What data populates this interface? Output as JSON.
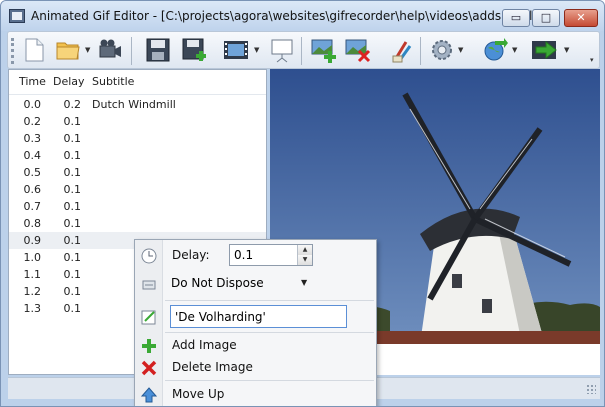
{
  "window": {
    "title": "Animated Gif Editor - [C:\\projects\\agora\\websites\\gifrecorder\\help\\videos\\addsubtitle..."
  },
  "window_controls": {
    "minimize": "▭",
    "maximize": "□",
    "close": "✕"
  },
  "toolbar": {
    "buttons": [
      {
        "name": "new-document",
        "icon": "new-document-icon"
      },
      {
        "name": "open-folder",
        "icon": "folder-icon"
      },
      {
        "name": "record-video",
        "icon": "video-camera-icon"
      },
      {
        "name": "save",
        "icon": "floppy-disk-icon"
      },
      {
        "name": "save-as",
        "icon": "floppy-add-icon"
      },
      {
        "name": "film-strip",
        "icon": "film-strip-icon"
      },
      {
        "name": "presentation",
        "icon": "presentation-icon"
      },
      {
        "name": "add-image",
        "icon": "image-add-icon"
      },
      {
        "name": "delete-image",
        "icon": "image-delete-icon"
      },
      {
        "name": "edit-image",
        "icon": "paint-tools-icon"
      },
      {
        "name": "settings",
        "icon": "gear-icon"
      },
      {
        "name": "web-export",
        "icon": "globe-export-icon"
      },
      {
        "name": "export-go",
        "icon": "green-arrow-icon"
      }
    ],
    "overflow": "▾"
  },
  "frame_list": {
    "columns": [
      "Time",
      "Delay",
      "Subtitle"
    ],
    "rows": [
      {
        "time": "0.0",
        "delay": "0.2",
        "subtitle": "Dutch Windmill"
      },
      {
        "time": "0.2",
        "delay": "0.1",
        "subtitle": ""
      },
      {
        "time": "0.3",
        "delay": "0.1",
        "subtitle": ""
      },
      {
        "time": "0.4",
        "delay": "0.1",
        "subtitle": ""
      },
      {
        "time": "0.5",
        "delay": "0.1",
        "subtitle": ""
      },
      {
        "time": "0.6",
        "delay": "0.1",
        "subtitle": ""
      },
      {
        "time": "0.7",
        "delay": "0.1",
        "subtitle": ""
      },
      {
        "time": "0.8",
        "delay": "0.1",
        "subtitle": ""
      },
      {
        "time": "0.9",
        "delay": "0.1",
        "subtitle": ""
      },
      {
        "time": "1.0",
        "delay": "0.1",
        "subtitle": ""
      },
      {
        "time": "1.1",
        "delay": "0.1",
        "subtitle": ""
      },
      {
        "time": "1.2",
        "delay": "0.1",
        "subtitle": ""
      },
      {
        "time": "1.3",
        "delay": "0.1",
        "subtitle": ""
      }
    ],
    "selected_index": 8
  },
  "context_menu": {
    "delay_label": "Delay:",
    "delay_value": "0.1",
    "dispose_value": "Do Not Dispose",
    "subtitle_value": "'De Volharding'",
    "items": [
      {
        "label": "Add Image",
        "icon": "add-icon"
      },
      {
        "label": "Delete Image",
        "icon": "delete-icon"
      },
      {
        "label": "Move Up",
        "icon": "up-arrow-icon"
      }
    ]
  },
  "colors": {
    "selection": "#eceff3",
    "sky": "#3c5f9c",
    "accent": "#5b8fd6"
  }
}
